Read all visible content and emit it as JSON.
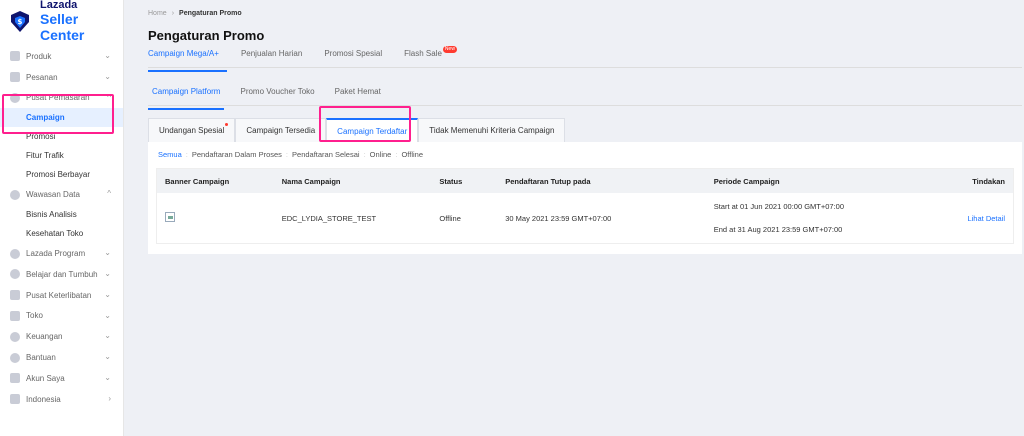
{
  "brand": {
    "line1": "Lazada",
    "line2": "Seller Center",
    "color_dark": "#0f146d",
    "color_accent": "#1a71ff"
  },
  "sidebar": {
    "items": [
      {
        "label": "Produk",
        "icon": "box-icon"
      },
      {
        "label": "Pesanan",
        "icon": "list-icon"
      },
      {
        "label": "Pusat Pemasaran",
        "icon": "megaphone-icon",
        "expanded": true,
        "children": [
          {
            "label": "Campaign",
            "active": true
          },
          {
            "label": "Promosi"
          },
          {
            "label": "Fitur Trafik"
          },
          {
            "label": "Promosi Berbayar"
          }
        ]
      },
      {
        "label": "Wawasan Data",
        "icon": "chart-icon",
        "expanded": true,
        "children": [
          {
            "label": "Bisnis Analisis"
          },
          {
            "label": "Kesehatan Toko"
          }
        ]
      },
      {
        "label": "Lazada Program",
        "icon": "star-icon"
      },
      {
        "label": "Belajar dan Tumbuh",
        "icon": "learn-icon"
      },
      {
        "label": "Pusat Keterlibatan",
        "icon": "engagement-icon"
      },
      {
        "label": "Toko",
        "icon": "store-icon"
      },
      {
        "label": "Keuangan",
        "icon": "finance-icon"
      },
      {
        "label": "Bantuan",
        "icon": "help-icon"
      },
      {
        "label": "Akun Saya",
        "icon": "account-icon"
      },
      {
        "label": "Indonesia",
        "icon": "flag-icon"
      }
    ]
  },
  "breadcrumb": {
    "home": "Home",
    "separator": "›",
    "current": "Pengaturan Promo"
  },
  "page_title": "Pengaturan Promo",
  "tabs_level1": [
    {
      "label": "Campaign Mega/A+",
      "active": true
    },
    {
      "label": "Penjualan Harian"
    },
    {
      "label": "Promosi Spesial"
    },
    {
      "label": "Flash Sale",
      "badge": "New"
    }
  ],
  "tabs_level2": [
    {
      "label": "Campaign Platform",
      "active": true
    },
    {
      "label": "Promo Voucher Toko"
    },
    {
      "label": "Paket Hemat"
    }
  ],
  "tabs_level3": [
    {
      "label": "Undangan Spesial",
      "dot": true
    },
    {
      "label": "Campaign Tersedia"
    },
    {
      "label": "Campaign Terdaftar",
      "active": true
    },
    {
      "label": "Tidak Memenuhi Kriteria Campaign"
    }
  ],
  "filters": [
    "Semua",
    "Pendaftaran Dalam Proses",
    "Pendaftaran Selesai",
    "Online",
    "Offline"
  ],
  "filter_separator": ":",
  "table": {
    "headers": [
      "Banner Campaign",
      "Nama Campaign",
      "Status",
      "Pendaftaran Tutup pada",
      "Periode Campaign",
      "Tindakan"
    ],
    "rows": [
      {
        "name": "EDC_LYDIA_STORE_TEST",
        "status": "Offline",
        "close_at": "30 May 2021 23:59 GMT+07:00",
        "period_start": "Start at 01 Jun 2021 00:00 GMT+07:00",
        "period_end": "End at 31 Aug 2021 23:59 GMT+07:00",
        "action": "Lihat Detail"
      }
    ]
  },
  "highlight_color": "#ff1f8e"
}
